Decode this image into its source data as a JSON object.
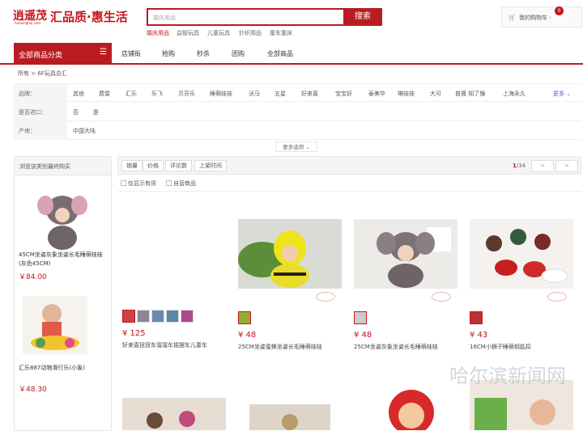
{
  "header": {
    "logo": "逍遥茂",
    "logo_sub": "huaxinghui.com",
    "slogan": "汇品质·惠生活",
    "search_placeholder": "婚庆用品",
    "search_button": "搜索",
    "hot_links": [
      "婚庆用品",
      "益智玩具",
      "儿童玩具",
      "针织用品",
      "童车童床"
    ],
    "cart_label": "我的购物车",
    "cart_count": "0"
  },
  "nav": {
    "category_label": "全部商品分类",
    "items": [
      "店铺街",
      "抢购",
      "秒杀",
      "团购",
      "全部商品"
    ]
  },
  "breadcrumb": {
    "root": "所有",
    "sep": ">",
    "current": "6F玩具总汇"
  },
  "filters": {
    "brand_label": "品牌：",
    "brands": [
      "其他",
      "费雷",
      "汇乐",
      "乐飞",
      "贝芬乐",
      "睡萌娃娃",
      "沃马",
      "五星",
      "好来喜",
      "宝宝好",
      "泰美华",
      "琳娃娃",
      "大可",
      "普晟 知了猴",
      "上海永久"
    ],
    "more": "更多",
    "import_label": "是否进口：",
    "import_values": [
      "否",
      "是"
    ],
    "origin_label": "产地：",
    "origin_values": [
      "中国大陆"
    ],
    "more_options": "更多选项"
  },
  "sidebar": {
    "title": "浏览该类别最终购买",
    "items": [
      {
        "title": "45CM坐姿灰象坐姿长毛睡萌娃娃(灰色45CM)",
        "price": "￥84.00"
      },
      {
        "title": "汇乐887动物滑行乐(小象)",
        "price": "￥48.30"
      }
    ]
  },
  "toolbar": {
    "sorts": [
      "销量",
      "价格",
      "评论数",
      "上架时间"
    ],
    "page_current": "1",
    "page_total": "/34",
    "prev": "<",
    "next": ">",
    "checks": [
      "仅显示有货",
      "自营商品"
    ]
  },
  "products": [
    {
      "price": "¥ 125",
      "title": "好来喜扭扭车溜溜车摇摆车儿童车"
    },
    {
      "price": "¥ 48",
      "title": "25CM坐姿蜜蜂坐姿长毛睡萌娃娃"
    },
    {
      "price": "¥ 48",
      "title": "25CM坐姿灰象坐姿长毛睡萌娃娃"
    },
    {
      "price": "¥ 43",
      "title": "16CM小狮子睡萌钥匙扣"
    }
  ],
  "watermark": "哈尔滨新闻网",
  "colors": {
    "brand_red": "#b81c22"
  }
}
